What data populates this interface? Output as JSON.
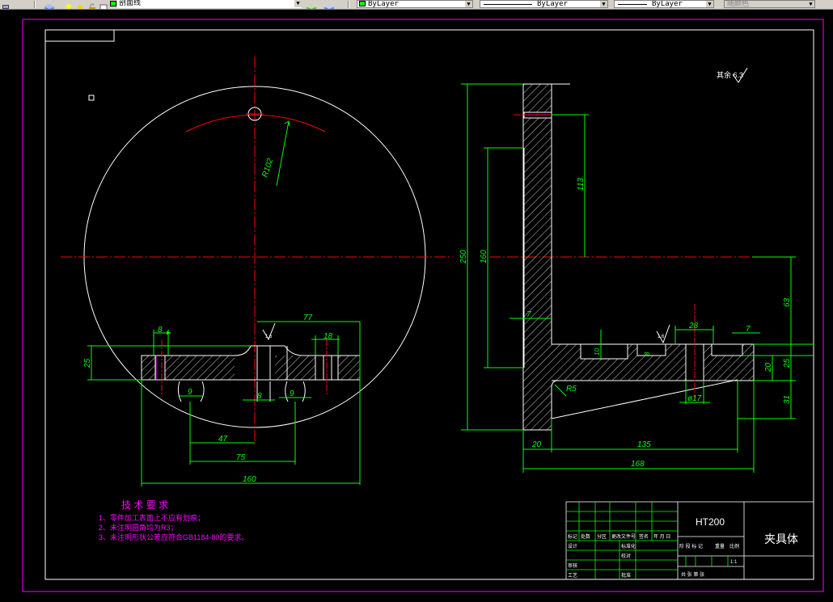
{
  "toolbar": {
    "layer_name": "剖面线",
    "color_combo": "ByLayer",
    "linetype_combo": "ByLayer",
    "lineweight_combo": "ByLayer",
    "plotstyle_combo": "随颜色"
  },
  "colors": {
    "background": "#000000",
    "outline": "#ffffff",
    "centerline": "#ff0000",
    "dimension": "#00ff00",
    "notes": "#ff00ff"
  },
  "drawing": {
    "dims": {
      "r102": "R102",
      "d8_top": "8",
      "d77": "77",
      "d18": "18",
      "d25_left": "25",
      "d9_a": "9",
      "d8_mid": "8",
      "d9_b": "9",
      "d47": "47",
      "d75": "75",
      "d160_bottom": "160",
      "rough_left": "1.6",
      "rough_right": "1.6",
      "d250": "250",
      "d160_vert": "160",
      "d113": "113",
      "d7_left": "7",
      "d10": "10",
      "d8_small": "8",
      "d28": "28",
      "d7_right": "7",
      "d63": "63",
      "d20_right": "20",
      "d25_right": "25",
      "d31": "31",
      "r5": "R5",
      "phi17": "ø17",
      "d20_bottom": "20",
      "d135": "135",
      "d168": "168"
    },
    "roughness_note": "其余 6.3",
    "tech_requirements": {
      "title": "技 术 要 求",
      "items": [
        "1、零件加工表面上不应有划痕；",
        "2、未注明圆角均为R3；",
        "3、未注明形状公差应符合GB1184-80的要求。"
      ]
    },
    "title_block": {
      "material": "HT200",
      "part_name": "夹具体",
      "labels": {
        "biaoji": "标记",
        "chushu": "处数",
        "fenqu": "分区",
        "gengaiwenjian": "更改文件号",
        "qianming": "签名",
        "nianyueri": "年 月 日",
        "sheji": "设计",
        "biaozhunhua": "标准化",
        "jieduanbiaoji": "阶 段 标 记",
        "zhongliang": "重量",
        "bili": "比例",
        "scale_value": "1:1",
        "jiaodui": "校对",
        "shenhe": "审核",
        "gongyi": "工艺",
        "pizhun": "批准",
        "gongzhang": "共   张   第   张"
      }
    }
  }
}
